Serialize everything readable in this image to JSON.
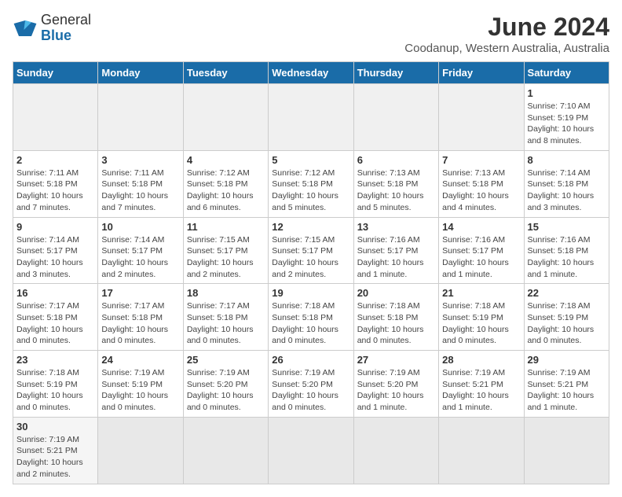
{
  "header": {
    "logo_text_normal": "General",
    "logo_text_bold": "Blue",
    "month_year": "June 2024",
    "location": "Coodanup, Western Australia, Australia"
  },
  "days_of_week": [
    "Sunday",
    "Monday",
    "Tuesday",
    "Wednesday",
    "Thursday",
    "Friday",
    "Saturday"
  ],
  "weeks": [
    [
      {
        "day": "",
        "info": "",
        "empty": true
      },
      {
        "day": "",
        "info": "",
        "empty": true
      },
      {
        "day": "",
        "info": "",
        "empty": true
      },
      {
        "day": "",
        "info": "",
        "empty": true
      },
      {
        "day": "",
        "info": "",
        "empty": true
      },
      {
        "day": "",
        "info": "",
        "empty": true
      },
      {
        "day": "1",
        "info": "Sunrise: 7:10 AM\nSunset: 5:19 PM\nDaylight: 10 hours\nand 8 minutes."
      }
    ],
    [
      {
        "day": "2",
        "info": "Sunrise: 7:11 AM\nSunset: 5:18 PM\nDaylight: 10 hours\nand 7 minutes."
      },
      {
        "day": "3",
        "info": "Sunrise: 7:11 AM\nSunset: 5:18 PM\nDaylight: 10 hours\nand 7 minutes."
      },
      {
        "day": "4",
        "info": "Sunrise: 7:12 AM\nSunset: 5:18 PM\nDaylight: 10 hours\nand 6 minutes."
      },
      {
        "day": "5",
        "info": "Sunrise: 7:12 AM\nSunset: 5:18 PM\nDaylight: 10 hours\nand 5 minutes."
      },
      {
        "day": "6",
        "info": "Sunrise: 7:13 AM\nSunset: 5:18 PM\nDaylight: 10 hours\nand 5 minutes."
      },
      {
        "day": "7",
        "info": "Sunrise: 7:13 AM\nSunset: 5:18 PM\nDaylight: 10 hours\nand 4 minutes."
      },
      {
        "day": "8",
        "info": "Sunrise: 7:14 AM\nSunset: 5:18 PM\nDaylight: 10 hours\nand 3 minutes."
      }
    ],
    [
      {
        "day": "9",
        "info": "Sunrise: 7:14 AM\nSunset: 5:17 PM\nDaylight: 10 hours\nand 3 minutes."
      },
      {
        "day": "10",
        "info": "Sunrise: 7:14 AM\nSunset: 5:17 PM\nDaylight: 10 hours\nand 2 minutes."
      },
      {
        "day": "11",
        "info": "Sunrise: 7:15 AM\nSunset: 5:17 PM\nDaylight: 10 hours\nand 2 minutes."
      },
      {
        "day": "12",
        "info": "Sunrise: 7:15 AM\nSunset: 5:17 PM\nDaylight: 10 hours\nand 2 minutes."
      },
      {
        "day": "13",
        "info": "Sunrise: 7:16 AM\nSunset: 5:17 PM\nDaylight: 10 hours\nand 1 minute."
      },
      {
        "day": "14",
        "info": "Sunrise: 7:16 AM\nSunset: 5:17 PM\nDaylight: 10 hours\nand 1 minute."
      },
      {
        "day": "15",
        "info": "Sunrise: 7:16 AM\nSunset: 5:18 PM\nDaylight: 10 hours\nand 1 minute."
      }
    ],
    [
      {
        "day": "16",
        "info": "Sunrise: 7:17 AM\nSunset: 5:18 PM\nDaylight: 10 hours\nand 0 minutes."
      },
      {
        "day": "17",
        "info": "Sunrise: 7:17 AM\nSunset: 5:18 PM\nDaylight: 10 hours\nand 0 minutes."
      },
      {
        "day": "18",
        "info": "Sunrise: 7:17 AM\nSunset: 5:18 PM\nDaylight: 10 hours\nand 0 minutes."
      },
      {
        "day": "19",
        "info": "Sunrise: 7:18 AM\nSunset: 5:18 PM\nDaylight: 10 hours\nand 0 minutes."
      },
      {
        "day": "20",
        "info": "Sunrise: 7:18 AM\nSunset: 5:18 PM\nDaylight: 10 hours\nand 0 minutes."
      },
      {
        "day": "21",
        "info": "Sunrise: 7:18 AM\nSunset: 5:19 PM\nDaylight: 10 hours\nand 0 minutes."
      },
      {
        "day": "22",
        "info": "Sunrise: 7:18 AM\nSunset: 5:19 PM\nDaylight: 10 hours\nand 0 minutes."
      }
    ],
    [
      {
        "day": "23",
        "info": "Sunrise: 7:18 AM\nSunset: 5:19 PM\nDaylight: 10 hours\nand 0 minutes."
      },
      {
        "day": "24",
        "info": "Sunrise: 7:19 AM\nSunset: 5:19 PM\nDaylight: 10 hours\nand 0 minutes."
      },
      {
        "day": "25",
        "info": "Sunrise: 7:19 AM\nSunset: 5:20 PM\nDaylight: 10 hours\nand 0 minutes."
      },
      {
        "day": "26",
        "info": "Sunrise: 7:19 AM\nSunset: 5:20 PM\nDaylight: 10 hours\nand 0 minutes."
      },
      {
        "day": "27",
        "info": "Sunrise: 7:19 AM\nSunset: 5:20 PM\nDaylight: 10 hours\nand 1 minute."
      },
      {
        "day": "28",
        "info": "Sunrise: 7:19 AM\nSunset: 5:21 PM\nDaylight: 10 hours\nand 1 minute."
      },
      {
        "day": "29",
        "info": "Sunrise: 7:19 AM\nSunset: 5:21 PM\nDaylight: 10 hours\nand 1 minute."
      }
    ],
    [
      {
        "day": "30",
        "info": "Sunrise: 7:19 AM\nSunset: 5:21 PM\nDaylight: 10 hours\nand 2 minutes."
      },
      {
        "day": "",
        "info": "",
        "empty": true
      },
      {
        "day": "",
        "info": "",
        "empty": true
      },
      {
        "day": "",
        "info": "",
        "empty": true
      },
      {
        "day": "",
        "info": "",
        "empty": true
      },
      {
        "day": "",
        "info": "",
        "empty": true
      },
      {
        "day": "",
        "info": "",
        "empty": true
      }
    ]
  ]
}
